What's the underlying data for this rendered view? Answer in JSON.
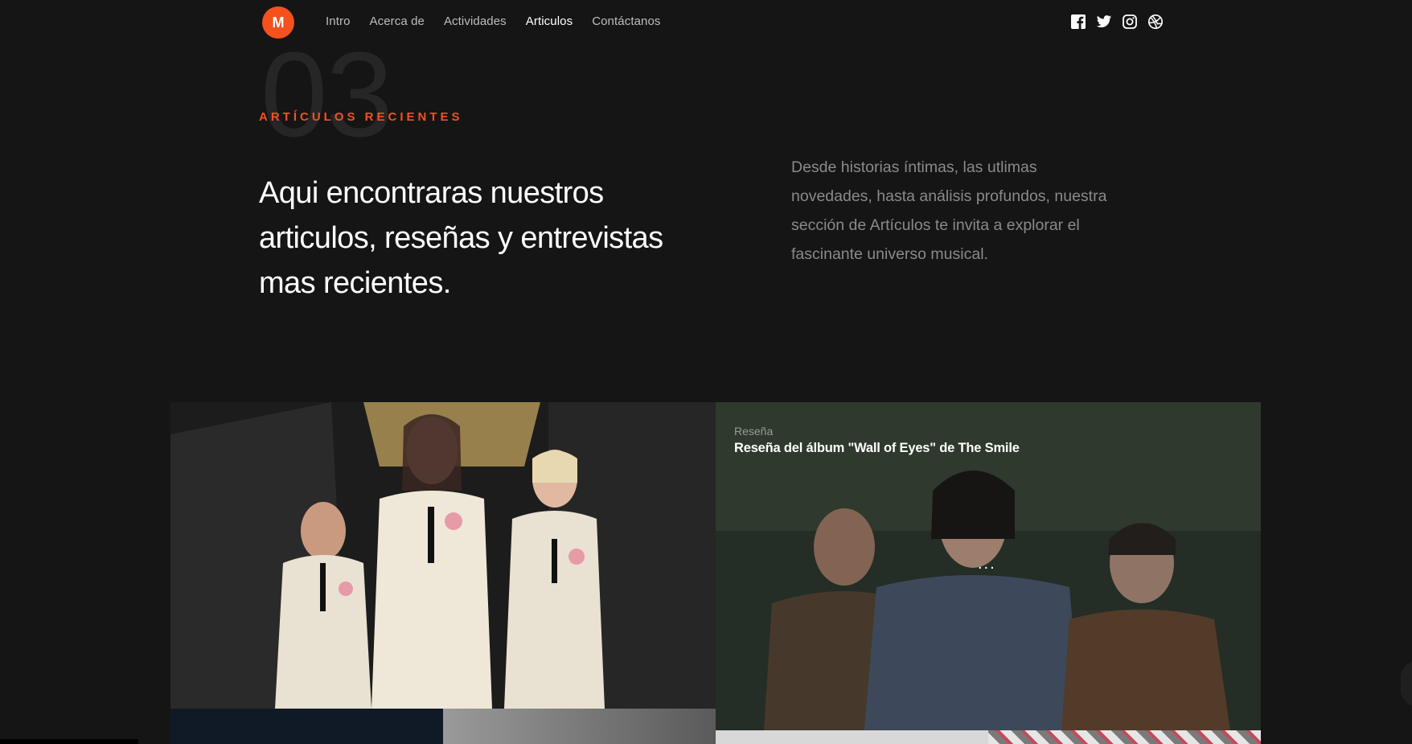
{
  "header": {
    "logo_letter": "M",
    "nav": [
      {
        "label": "Intro",
        "active": false
      },
      {
        "label": "Acerca de",
        "active": false
      },
      {
        "label": "Actividades",
        "active": false
      },
      {
        "label": "Articulos",
        "active": true
      },
      {
        "label": "Contáctanos",
        "active": false
      }
    ],
    "social_icons": [
      "facebook-icon",
      "twitter-icon",
      "instagram-icon",
      "dribbble-icon"
    ]
  },
  "section": {
    "number": "03",
    "kicker": "ARTÍCULOS RECIENTES",
    "heading": "Aqui encontraras nuestros articulos, reseñas y entrevistas mas recientes.",
    "lede": "Desde historias íntimas, las utlimas novedades, hasta análisis profundos, nuestra sección de Artículos te invita a explorar el fascinante universo musical."
  },
  "articles": [
    {
      "category": "Reseña",
      "title": "Reseña del álbum \"Wall of Eyes\" de The Smile",
      "more": "..."
    }
  ],
  "colors": {
    "accent": "#f4511e",
    "background": "#151515"
  }
}
